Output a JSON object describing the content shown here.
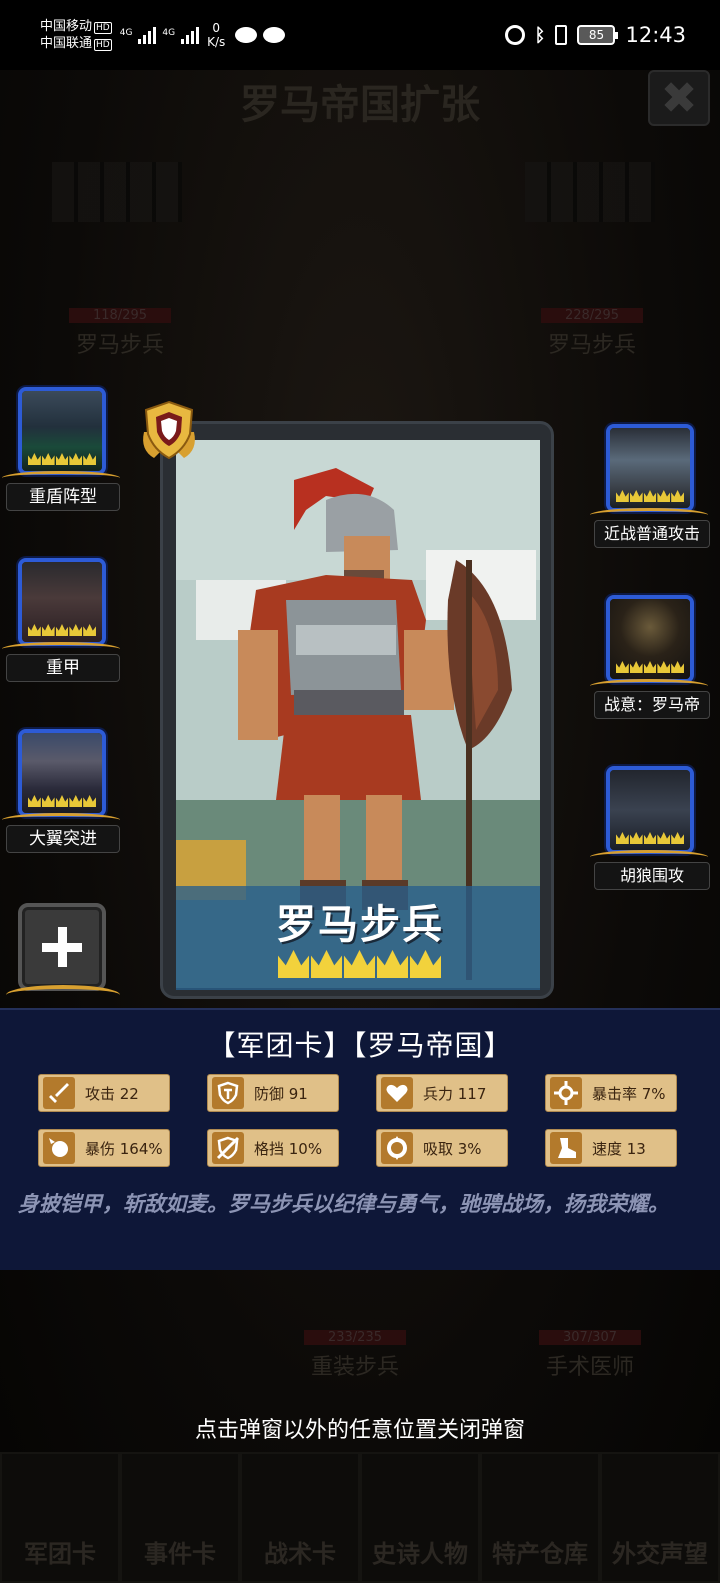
{
  "status_bar": {
    "carrier1": "中国移动",
    "carrier2": "中国联通",
    "hd": "HD",
    "net1": "4G",
    "net2": "4G",
    "speed_value": "0",
    "speed_unit": "K/s",
    "battery": "85",
    "time": "12:43"
  },
  "game": {
    "title": "罗马帝国扩张",
    "close_label": "✖",
    "bg_units": [
      {
        "name": "罗马步兵",
        "hp": "118/295"
      },
      {
        "name": "罗马步兵",
        "hp": "228/295"
      },
      {
        "name": "重装步兵",
        "hp": "233/235"
      },
      {
        "name": "手术医师",
        "hp": "307/307"
      }
    ],
    "hint": "点击弹窗以外的任意位置关闭弹窗",
    "bottom_tabs": [
      "军团卡",
      "事件卡",
      "战术卡",
      "史诗人物",
      "特产仓库",
      "外交声望"
    ]
  },
  "skills_left": [
    {
      "name": "重盾阵型",
      "icon": "shield-wall-icon"
    },
    {
      "name": "重甲",
      "icon": "heavy-armor-icon"
    },
    {
      "name": "大翼突进",
      "icon": "wing-charge-icon"
    }
  ],
  "skills_right": [
    {
      "name": "近战普通攻击",
      "icon": "melee-attack-icon"
    },
    {
      "name": "战意：罗马帝",
      "icon": "war-spirit-icon"
    },
    {
      "name": "胡狼围攻",
      "icon": "jackal-siege-icon"
    }
  ],
  "card": {
    "name": "罗马步兵",
    "stars": 5,
    "badge_icon": "shield-badge-icon"
  },
  "info": {
    "tags": "【军团卡】【罗马帝国】",
    "stats": [
      {
        "label": "攻击 22",
        "icon": "sword-icon"
      },
      {
        "label": "防御 91",
        "icon": "shield-icon"
      },
      {
        "label": "兵力 117",
        "icon": "heart-icon"
      },
      {
        "label": "暴击率 7%",
        "icon": "crosshair-icon"
      },
      {
        "label": "暴伤 164%",
        "icon": "burst-icon"
      },
      {
        "label": "格挡 10%",
        "icon": "block-icon"
      },
      {
        "label": "吸取 3%",
        "icon": "drain-icon"
      },
      {
        "label": "速度 13",
        "icon": "boot-icon"
      }
    ],
    "description": "身披铠甲，斩敌如麦。罗马步兵以纪律与勇气，驰骋战场，扬我荣耀。"
  },
  "colors": {
    "panel_bg": "#0e1738",
    "stat_bg": "#e0c088",
    "stat_icon_bg": "#b37a2c",
    "frame_blue": "#2d5bd6",
    "crown_gold": "#f2d23c"
  }
}
